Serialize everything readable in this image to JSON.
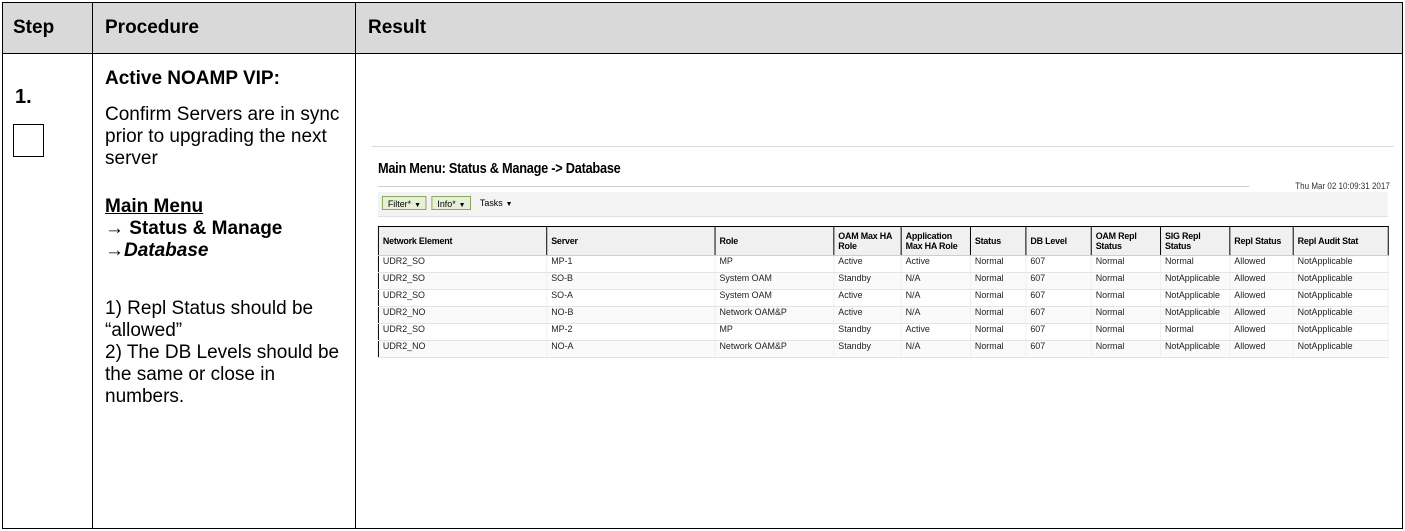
{
  "header": {
    "step": "Step",
    "procedure": "Procedure",
    "result": "Result"
  },
  "step": {
    "number": "1."
  },
  "procedure": {
    "title": "Active NOAMP VIP:",
    "description": "Confirm Servers are in sync prior to upgrading the next server",
    "nav_menu": "Main Menu",
    "nav_status": "→ Status & Manage",
    "nav_database_arrow": "→",
    "nav_database": "Database",
    "note1": "1) Repl Status should be “allowed”",
    "note2": "2) The DB Levels should be the same or close in numbers."
  },
  "screenshot": {
    "title": "Main Menu: Status & Manage -> Database",
    "timestamp": "Thu Mar 02 10:09:31 2017",
    "toolbar": {
      "filter": "Filter*",
      "info": "Info*",
      "tasks": "Tasks"
    },
    "columns": [
      "Network Element",
      "Server",
      "Role",
      "OAM Max HA Role",
      "Application Max HA Role",
      "Status",
      "DB Level",
      "OAM Repl Status",
      "SIG Repl Status",
      "Repl Status",
      "Repl Audit Stat"
    ],
    "rows": [
      [
        "UDR2_SO",
        "MP-1",
        "MP",
        "Active",
        "Active",
        "Normal",
        "607",
        "Normal",
        "Normal",
        "Allowed",
        "NotApplicable"
      ],
      [
        "UDR2_SO",
        "SO-B",
        "System OAM",
        "Standby",
        "N/A",
        "Normal",
        "607",
        "Normal",
        "NotApplicable",
        "Allowed",
        "NotApplicable"
      ],
      [
        "UDR2_SO",
        "SO-A",
        "System OAM",
        "Active",
        "N/A",
        "Normal",
        "607",
        "Normal",
        "NotApplicable",
        "Allowed",
        "NotApplicable"
      ],
      [
        "UDR2_NO",
        "NO-B",
        "Network OAM&P",
        "Active",
        "N/A",
        "Normal",
        "607",
        "Normal",
        "NotApplicable",
        "Allowed",
        "NotApplicable"
      ],
      [
        "UDR2_SO",
        "MP-2",
        "MP",
        "Standby",
        "Active",
        "Normal",
        "607",
        "Normal",
        "Normal",
        "Allowed",
        "NotApplicable"
      ],
      [
        "UDR2_NO",
        "NO-A",
        "Network OAM&P",
        "Standby",
        "N/A",
        "Normal",
        "607",
        "Normal",
        "NotApplicable",
        "Allowed",
        "NotApplicable"
      ]
    ]
  }
}
